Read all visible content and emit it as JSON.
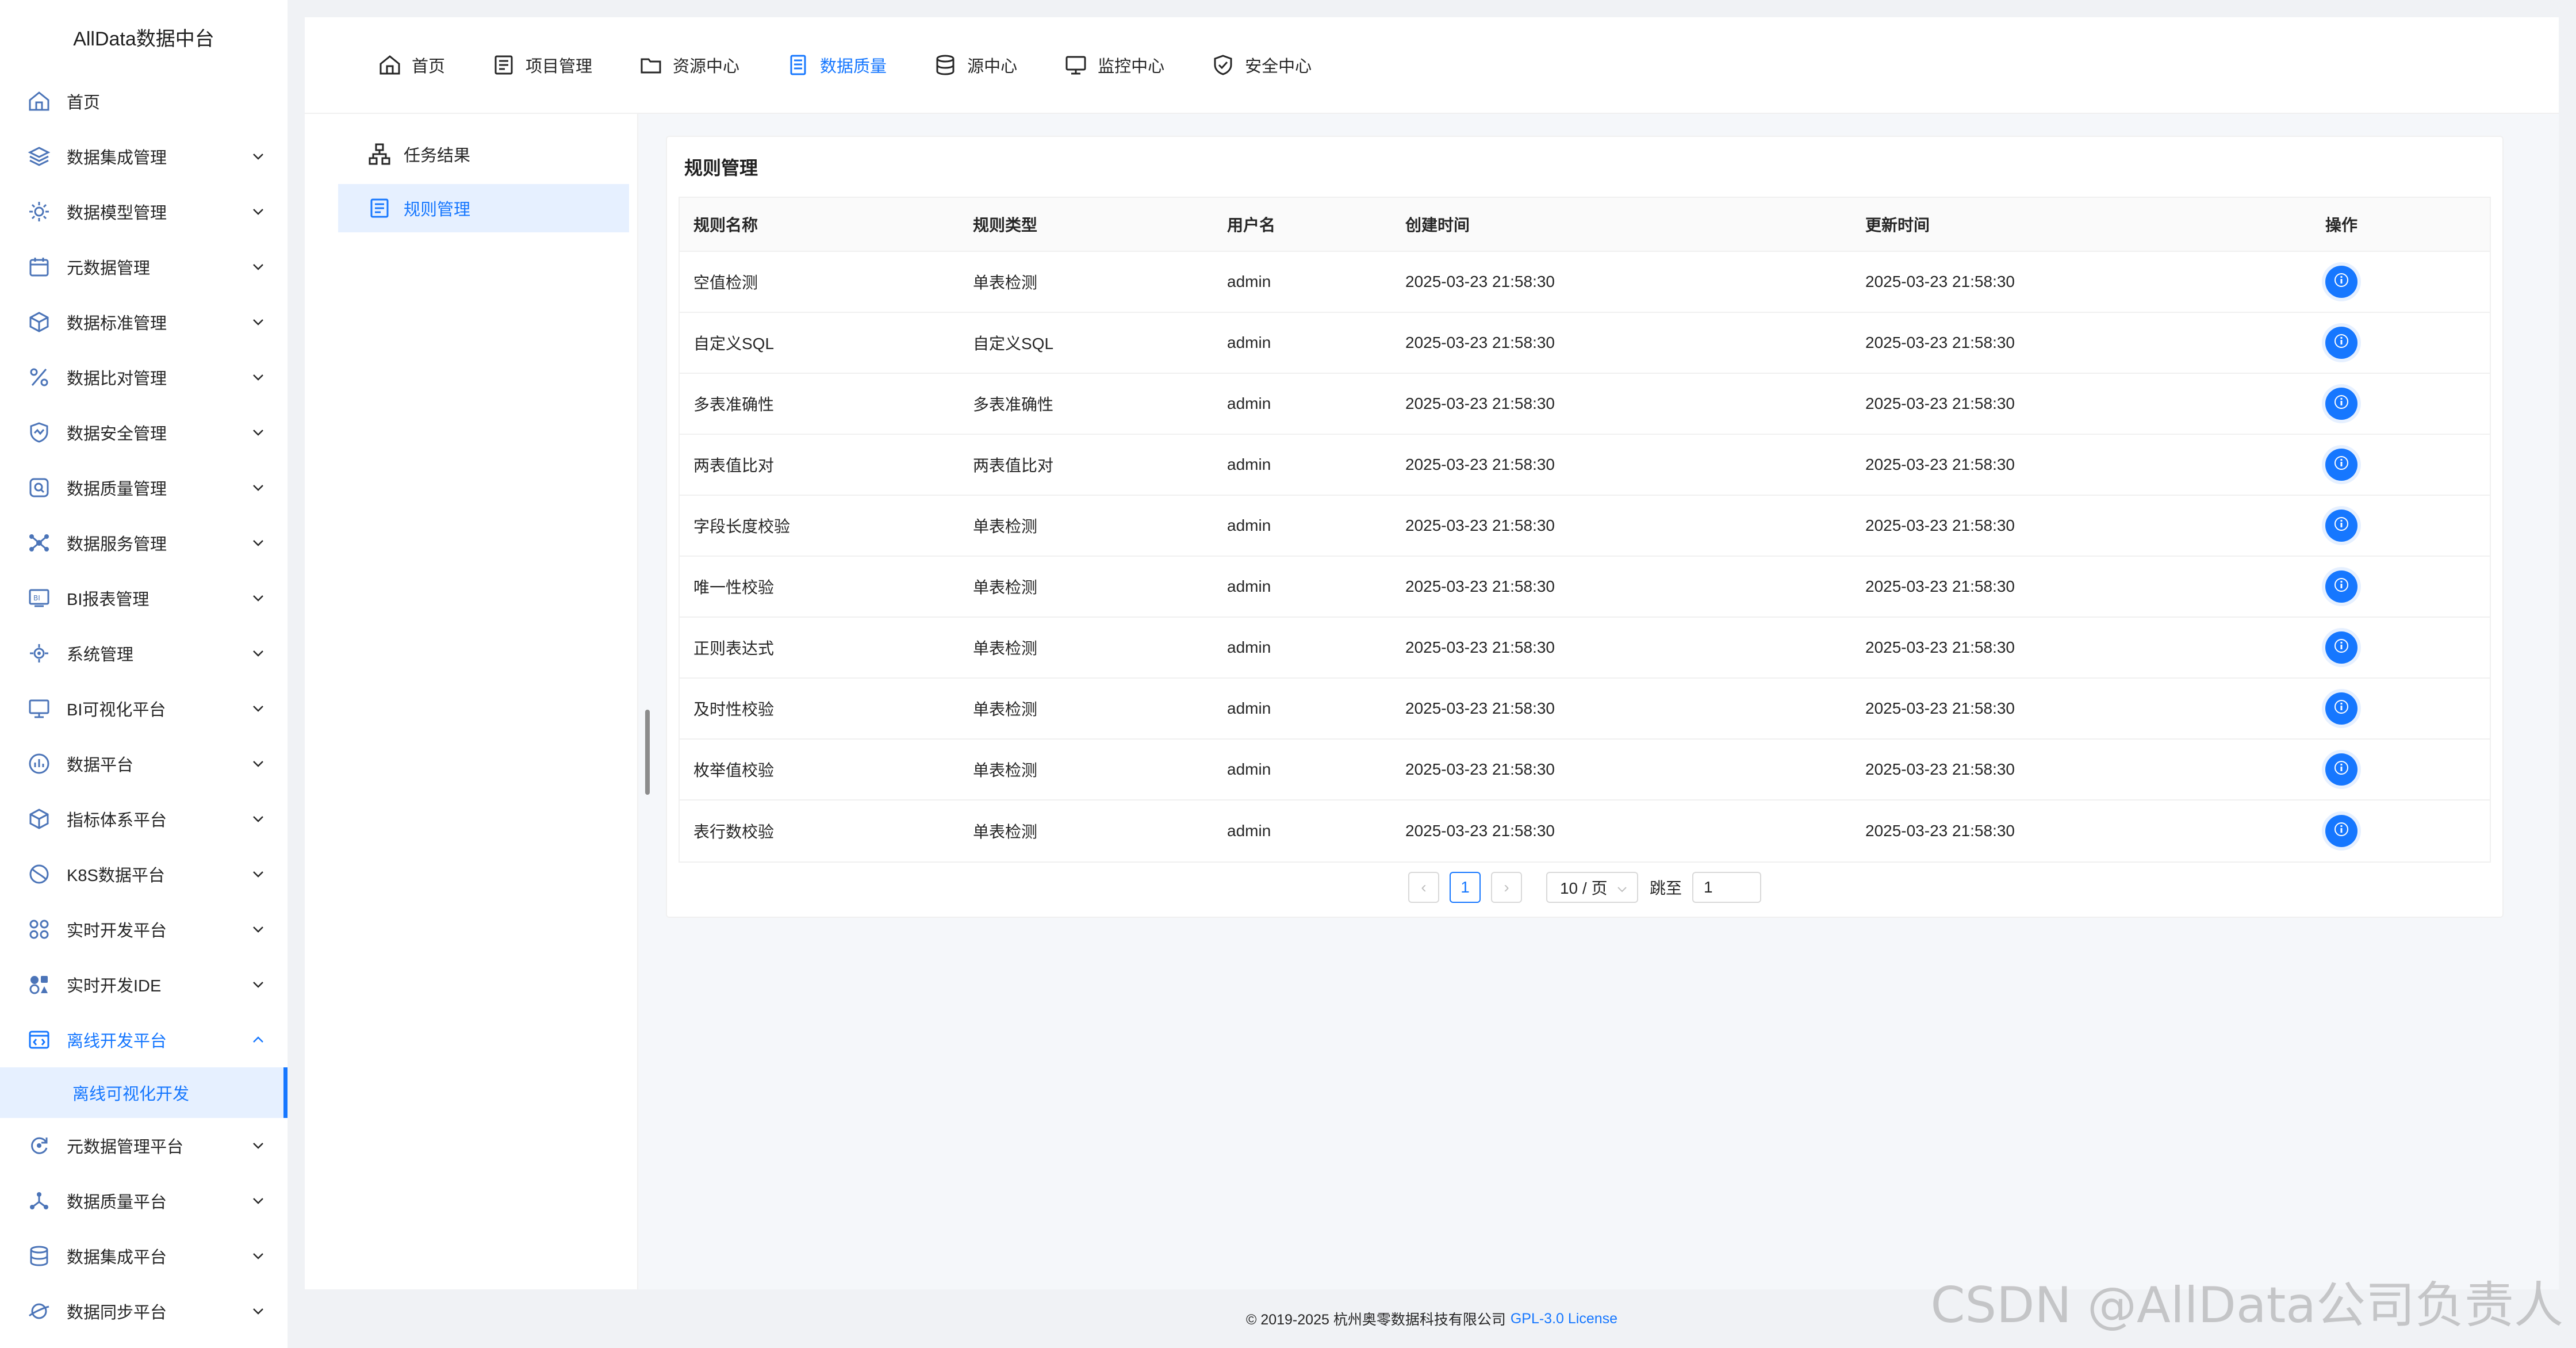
{
  "brand": "AllData数据中台",
  "sidebar": {
    "items": [
      {
        "label": "首页",
        "icon": "home-icon",
        "arrow": ""
      },
      {
        "label": "数据集成管理",
        "icon": "layers-icon",
        "arrow": "⌄"
      },
      {
        "label": "数据模型管理",
        "icon": "gear-icon",
        "arrow": "⌄"
      },
      {
        "label": "元数据管理",
        "icon": "calendar-icon",
        "arrow": "⌄"
      },
      {
        "label": "数据标准管理",
        "icon": "cube-icon",
        "arrow": "⌄"
      },
      {
        "label": "数据比对管理",
        "icon": "percent-icon",
        "arrow": "⌄"
      },
      {
        "label": "数据安全管理",
        "icon": "shield-icon",
        "arrow": "⌄"
      },
      {
        "label": "数据质量管理",
        "icon": "search-icon",
        "arrow": "⌄"
      },
      {
        "label": "数据服务管理",
        "icon": "network-icon",
        "arrow": "⌄"
      },
      {
        "label": "BI报表管理",
        "icon": "bi-report-icon",
        "arrow": "⌄"
      },
      {
        "label": "系统管理",
        "icon": "settings-icon",
        "arrow": "⌄"
      },
      {
        "label": "BI可视化平台",
        "icon": "monitor-icon",
        "arrow": "⌄"
      },
      {
        "label": "数据平台",
        "icon": "bar-chart-icon",
        "arrow": "⌄"
      },
      {
        "label": "指标体系平台",
        "icon": "box-icon",
        "arrow": "⌄"
      },
      {
        "label": "K8S数据平台",
        "icon": "globe-icon",
        "arrow": "⌄"
      },
      {
        "label": "实时开发平台",
        "icon": "grid-icon",
        "arrow": "⌄"
      },
      {
        "label": "实时开发IDE",
        "icon": "pie-icon",
        "arrow": "⌄"
      }
    ],
    "open_item": {
      "label": "离线开发平台",
      "icon": "code-icon",
      "arrow": "⌃"
    },
    "open_sub": "离线可视化开发",
    "items_after": [
      {
        "label": "元数据管理平台",
        "icon": "sync-icon",
        "arrow": "⌄"
      },
      {
        "label": "数据质量平台",
        "icon": "nodes-icon",
        "arrow": "⌄"
      },
      {
        "label": "数据集成平台",
        "icon": "database-icon",
        "arrow": "⌄"
      },
      {
        "label": "数据同步平台",
        "icon": "planet-icon",
        "arrow": "⌄"
      }
    ]
  },
  "topnav": {
    "tabs": [
      {
        "label": "首页",
        "icon": "home-icon"
      },
      {
        "label": "项目管理",
        "icon": "list-icon"
      },
      {
        "label": "资源中心",
        "icon": "folder-icon"
      },
      {
        "label": "数据质量",
        "icon": "document-icon"
      },
      {
        "label": "源中心",
        "icon": "database-icon"
      },
      {
        "label": "监控中心",
        "icon": "monitor-icon"
      },
      {
        "label": "安全中心",
        "icon": "shield-check-icon"
      }
    ],
    "active_index": 3
  },
  "leftpanel": {
    "items": [
      {
        "label": "任务结果",
        "icon": "hierarchy-icon"
      },
      {
        "label": "规则管理",
        "icon": "list-icon"
      }
    ],
    "active_index": 1
  },
  "card": {
    "title": "规则管理",
    "columns": [
      "规则名称",
      "规则类型",
      "用户名",
      "创建时间",
      "更新时间",
      "操作"
    ],
    "rows": [
      [
        "空值检测",
        "单表检测",
        "admin",
        "2025-03-23 21:58:30",
        "2025-03-23 21:58:30"
      ],
      [
        "自定义SQL",
        "自定义SQL",
        "admin",
        "2025-03-23 21:58:30",
        "2025-03-23 21:58:30"
      ],
      [
        "多表准确性",
        "多表准确性",
        "admin",
        "2025-03-23 21:58:30",
        "2025-03-23 21:58:30"
      ],
      [
        "两表值比对",
        "两表值比对",
        "admin",
        "2025-03-23 21:58:30",
        "2025-03-23 21:58:30"
      ],
      [
        "字段长度校验",
        "单表检测",
        "admin",
        "2025-03-23 21:58:30",
        "2025-03-23 21:58:30"
      ],
      [
        "唯一性校验",
        "单表检测",
        "admin",
        "2025-03-23 21:58:30",
        "2025-03-23 21:58:30"
      ],
      [
        "正则表达式",
        "单表检测",
        "admin",
        "2025-03-23 21:58:30",
        "2025-03-23 21:58:30"
      ],
      [
        "及时性校验",
        "单表检测",
        "admin",
        "2025-03-23 21:58:30",
        "2025-03-23 21:58:30"
      ],
      [
        "枚举值校验",
        "单表检测",
        "admin",
        "2025-03-23 21:58:30",
        "2025-03-23 21:58:30"
      ],
      [
        "表行数校验",
        "单表检测",
        "admin",
        "2025-03-23 21:58:30",
        "2025-03-23 21:58:30"
      ]
    ]
  },
  "pagination": {
    "prev": "‹",
    "next": "›",
    "current_page": "1",
    "page_size": "10 / 页",
    "jump_label": "跳至",
    "jump_value": "1"
  },
  "footer": {
    "text": "© 2019-2025 杭州奥零数据科技有限公司",
    "link": "GPL-3.0 License"
  },
  "watermark": "CSDN @AllData公司负责人",
  "colors": {
    "accent": "#1677ff",
    "accent_bg": "#e6f0ff"
  }
}
